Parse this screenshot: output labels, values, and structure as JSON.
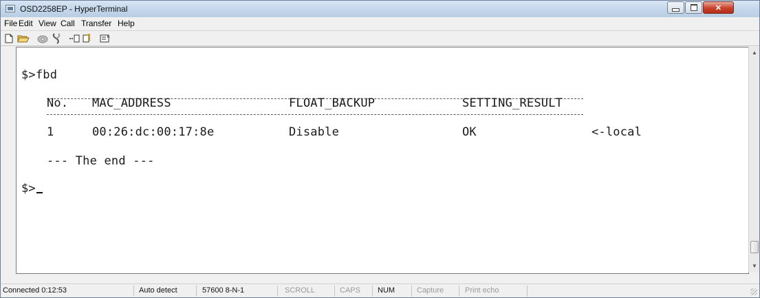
{
  "window": {
    "title": "OSD2258EP - HyperTerminal"
  },
  "menu": [
    "File",
    "Edit",
    "View",
    "Call",
    "Transfer",
    "Help"
  ],
  "toolbar": {
    "icons": [
      "new-document-icon",
      "open-folder-icon",
      "dial-phone-icon",
      "disconnect-icon",
      "send-icon",
      "receive-icon",
      "properties-icon"
    ]
  },
  "terminal": {
    "command_line": "$>fbd",
    "table": {
      "headers": [
        "No.",
        "MAC_ADDRESS",
        "FLOAT_BACKUP",
        "SETTING_RESULT"
      ],
      "rows": [
        {
          "no": "1",
          "mac": "00:26:dc:00:17:8e",
          "float_backup": "Disable",
          "result": "OK",
          "note": "<-local"
        }
      ]
    },
    "end_line": "--- The end ---",
    "prompt": "$>"
  },
  "status": {
    "connected": "Connected 0:12:53",
    "detect": "Auto detect",
    "baud": "57600 8-N-1",
    "scroll": "SCROLL",
    "caps": "CAPS",
    "num": "NUM",
    "capture": "Capture",
    "print_echo": "Print echo"
  }
}
